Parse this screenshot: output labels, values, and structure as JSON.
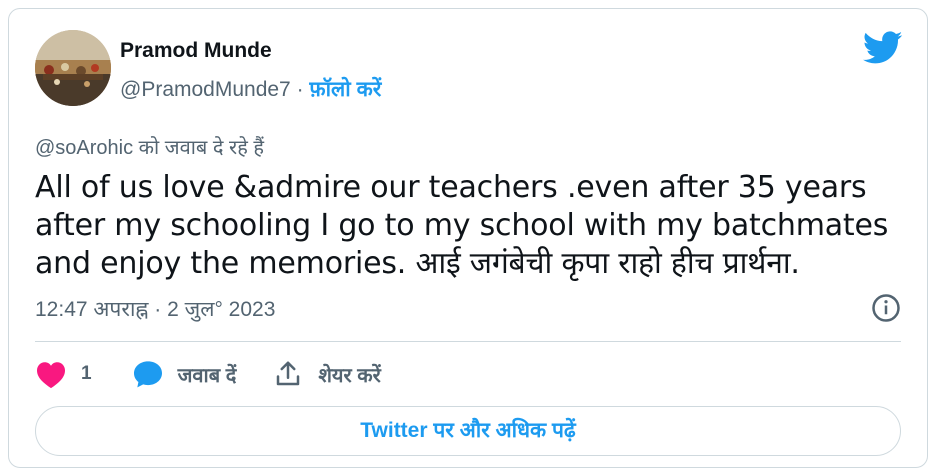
{
  "author": {
    "name": "Pramod Munde",
    "handle": "@PramodMunde7",
    "separator": " · ",
    "follow_label": "फ़ॉलो करें"
  },
  "tweet": {
    "reply_to": "@soArohic को जवाब दे रहे हैं",
    "text": "All of us love &admire our teachers .even after 35 years after my schooling I go to my school with my batchmates and enjoy the memories. आई जगंबेची कृपा राहो हीच प्रार्थना.",
    "timestamp": "12:47 अपराह्न · 2 जुल° 2023"
  },
  "actions": {
    "like_count": "1",
    "reply_label": "जवाब दें",
    "share_label": "शेयर करें"
  },
  "read_more_label": "Twitter पर और अधिक पढ़ें",
  "colors": {
    "brand_blue": "#1d9bf0",
    "like_pink": "#f91880",
    "text_primary": "#0f1419",
    "text_secondary": "#536471",
    "border": "#cfd9de"
  },
  "icons": {
    "logo": "twitter-bird-icon",
    "info": "info-icon",
    "like": "heart-icon",
    "reply": "speech-bubble-icon",
    "share": "share-upload-icon"
  }
}
